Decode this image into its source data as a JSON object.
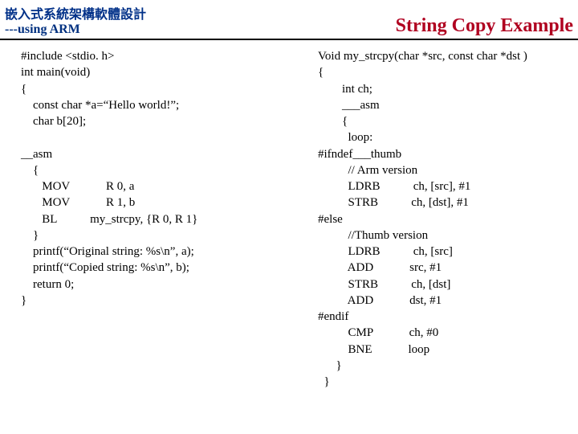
{
  "header": {
    "left_ch": "嵌入式系統架構軟體設計",
    "left_en": "---using ARM",
    "right": "String Copy Example"
  },
  "left_code": "#include <stdio. h>\nint main(void)\n{\n    const char *a=“Hello world!”;\n    char b[20];\n\n__asm\n    {\n       MOV            R 0, a\n       MOV            R 1, b\n       BL           my_strcpy, {R 0, R 1}\n    }\n    printf(“Original string: %s\\n”, a);\n    printf(“Copied string: %s\\n”, b);\n    return 0;\n}",
  "right_code": "Void my_strcpy(char *src, const char *dst )\n{\n        int ch;\n        ___asm\n        {\n          loop:\n#ifndef___thumb\n          // Arm version\n          LDRB           ch, [src], #1\n          STRB           ch, [dst], #1\n#else\n          //Thumb version\n          LDRB           ch, [src]\n          ADD            src, #1\n          STRB           ch, [dst]\n          ADD            dst, #1\n#endif\n          CMP            ch, #0\n          BNE            loop\n      }\n  }"
}
